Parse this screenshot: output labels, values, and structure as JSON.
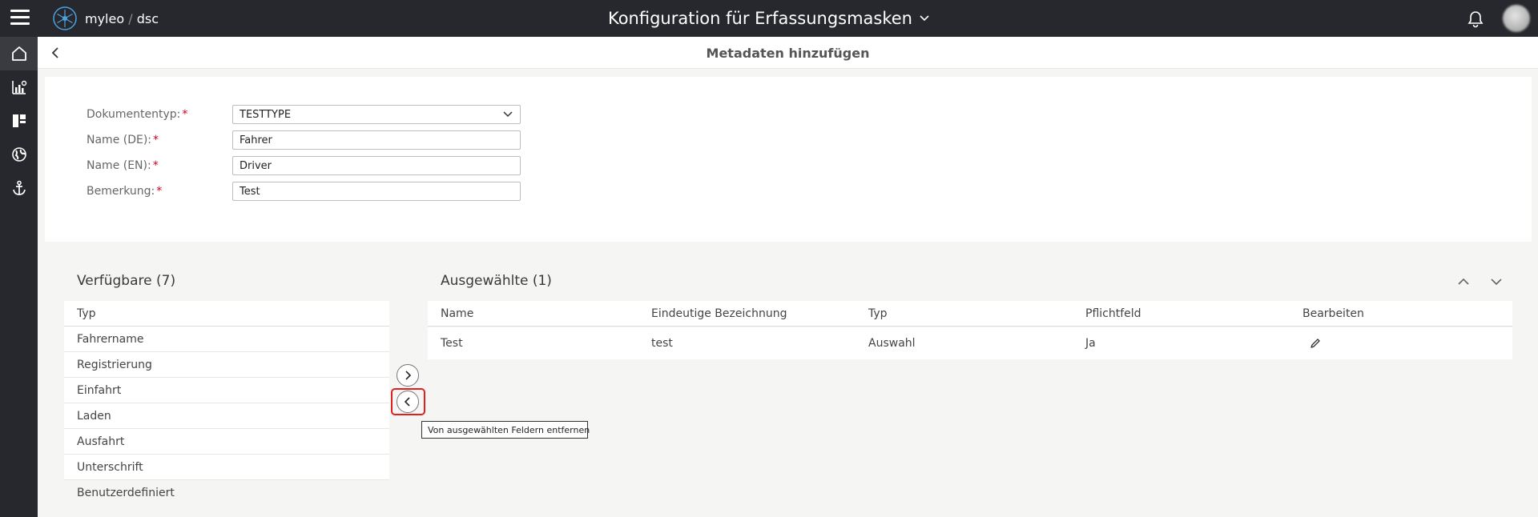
{
  "topbar": {
    "logo_name": "myleo",
    "logo_slash": "/",
    "logo_suffix": "dsc",
    "title": "Konfiguration für Erfassungsmasken"
  },
  "sidebar": {
    "items": [
      {
        "icon": "home-icon"
      },
      {
        "icon": "chart-icon"
      },
      {
        "icon": "dashboard-icon"
      },
      {
        "icon": "globe-icon"
      },
      {
        "icon": "anchor-icon"
      }
    ]
  },
  "subheader": {
    "title": "Metadaten hinzufügen"
  },
  "form": {
    "required_mark": "*",
    "doctype_label": "Dokumententyp:",
    "doctype_value": "TESTTYPE",
    "name_de_label": "Name (DE):",
    "name_de_value": "Fahrer",
    "name_en_label": "Name (EN):",
    "name_en_value": "Driver",
    "remark_label": "Bemerkung:",
    "remark_value": "Test"
  },
  "available": {
    "title": "Verfügbare (7)",
    "column": "Typ",
    "items": [
      "Fahrername",
      "Registrierung",
      "Einfahrt",
      "Laden",
      "Ausfahrt",
      "Unterschrift",
      "Benutzerdefiniert"
    ]
  },
  "selected": {
    "title": "Ausgewählte (1)",
    "columns": [
      "Name",
      "Eindeutige Bezeichnung",
      "Typ",
      "Pflichtfeld",
      "Bearbeiten"
    ],
    "rows": [
      {
        "name": "Test",
        "id": "test",
        "type": "Auswahl",
        "required": "Ja"
      }
    ]
  },
  "tooltip": {
    "text": "Von ausgewählten Feldern entfernen"
  },
  "colors": {
    "topbar": "#27282d",
    "required": "#d0021b",
    "highlight": "#e02020"
  }
}
